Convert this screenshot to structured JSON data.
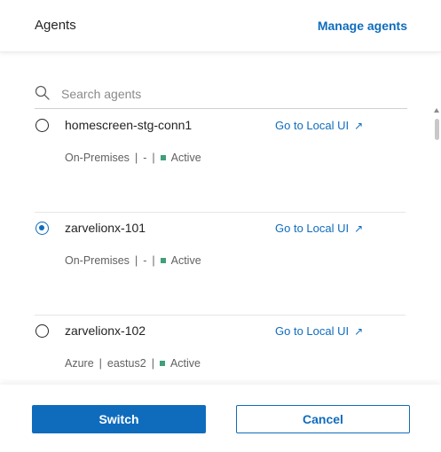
{
  "header": {
    "title": "Agents",
    "manage_label": "Manage agents"
  },
  "search": {
    "placeholder": "Search agents"
  },
  "agents": [
    {
      "name": "homescreen-stg-conn1",
      "selected": false,
      "link_label": "Go to Local UI",
      "location": "On-Premises",
      "region": "-",
      "status": "Active"
    },
    {
      "name": "zarvelionx-101",
      "selected": true,
      "link_label": "Go to Local UI",
      "location": "On-Premises",
      "region": "-",
      "status": "Active"
    },
    {
      "name": "zarvelionx-102",
      "selected": false,
      "link_label": "Go to Local UI",
      "location": "Azure",
      "region": "eastus2",
      "status": "Active"
    }
  ],
  "footer": {
    "switch_label": "Switch",
    "cancel_label": "Cancel"
  },
  "colors": {
    "accent": "#0f6cbd",
    "status_active": "#3fa07a"
  }
}
